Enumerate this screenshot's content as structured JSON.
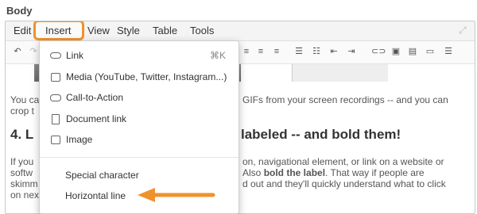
{
  "field_label": "Body",
  "menubar": {
    "items": [
      "Edit",
      "Insert",
      "View",
      "Style",
      "Table",
      "Tools"
    ]
  },
  "content": {
    "para1_left": "You ca",
    "para1_right": "GIFs from your screen recordings -- and you can",
    "para1b_left": "crop t",
    "heading_left": "4. L",
    "heading_right": "labeled -- and bold them!",
    "para2_left": "If you",
    "para2_right": "on, navigational element, or link on a website or",
    "para3_left": "softw",
    "para3_right": "Also",
    "para3_bold": "bold the label",
    "para3_rest": ". That way if people are",
    "para4_left": "skimm",
    "para4_right": "d out and they'll quickly understand what to click",
    "para5_left": "on nex"
  },
  "insert_menu": {
    "items": [
      {
        "label": "Link",
        "shortcut": "⌘K",
        "icon": "link-icon"
      },
      {
        "label": "Media (YouTube, Twitter, Instagram...)",
        "icon": "media-icon"
      },
      {
        "label": "Call-to-Action",
        "icon": "cta-icon"
      },
      {
        "label": "Document link",
        "icon": "document-icon"
      },
      {
        "label": "Image",
        "icon": "image-icon"
      },
      {
        "label": "Special character"
      },
      {
        "label": "Horizontal line"
      }
    ]
  },
  "colors": {
    "highlight": "#f0922b"
  }
}
